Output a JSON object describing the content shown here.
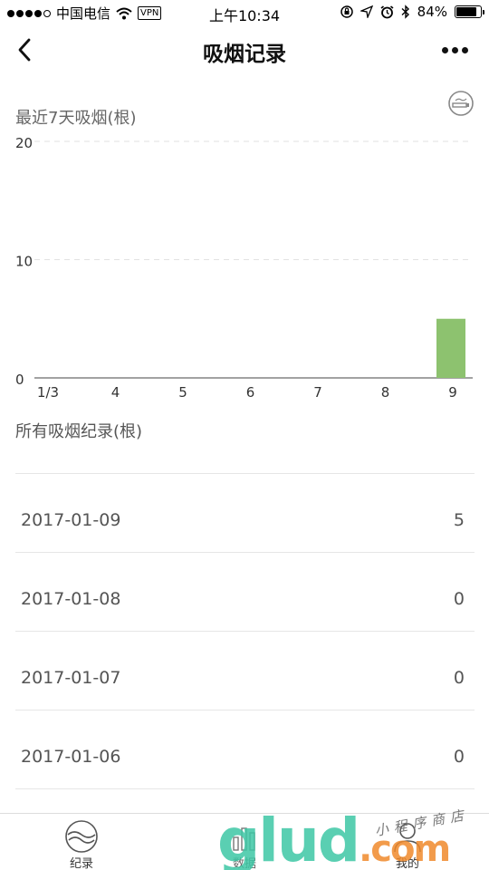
{
  "status_bar": {
    "carrier": "中国电信",
    "vpn": "VPN",
    "time": "上午10:34",
    "battery_percent": "84%",
    "battery_level": 0.84
  },
  "nav": {
    "title": "吸烟记录",
    "back_icon": "chevron-left-icon",
    "more_icon": "ellipsis-icon"
  },
  "chart_section": {
    "title": "最近7天吸烟(根)",
    "smoke_icon": "cigarette-icon"
  },
  "chart_data": {
    "type": "bar",
    "categories": [
      "1/3",
      "4",
      "5",
      "6",
      "7",
      "8",
      "9"
    ],
    "values": [
      0,
      0,
      0,
      0,
      0,
      0,
      5
    ],
    "yticks": [
      "0",
      "10",
      "20"
    ],
    "ylim": [
      0,
      20
    ],
    "grid": true,
    "bar_color": "#8dc26f"
  },
  "records_section": {
    "title": "所有吸烟纪录(根)",
    "items": [
      {
        "date": "2017-01-09",
        "count": "5"
      },
      {
        "date": "2017-01-08",
        "count": "0"
      },
      {
        "date": "2017-01-07",
        "count": "0"
      },
      {
        "date": "2017-01-06",
        "count": "0"
      }
    ]
  },
  "tabbar": {
    "tabs": [
      {
        "label": "纪录",
        "icon": "wave-circle-icon"
      },
      {
        "label": "数据",
        "icon": "bar-chart-icon"
      },
      {
        "label": "我的",
        "icon": "user-icon"
      }
    ]
  },
  "watermark": {
    "text": "glud.com",
    "subtitle": "小程序商店",
    "colors": [
      "#3dc7a4",
      "#f08a2c"
    ]
  }
}
